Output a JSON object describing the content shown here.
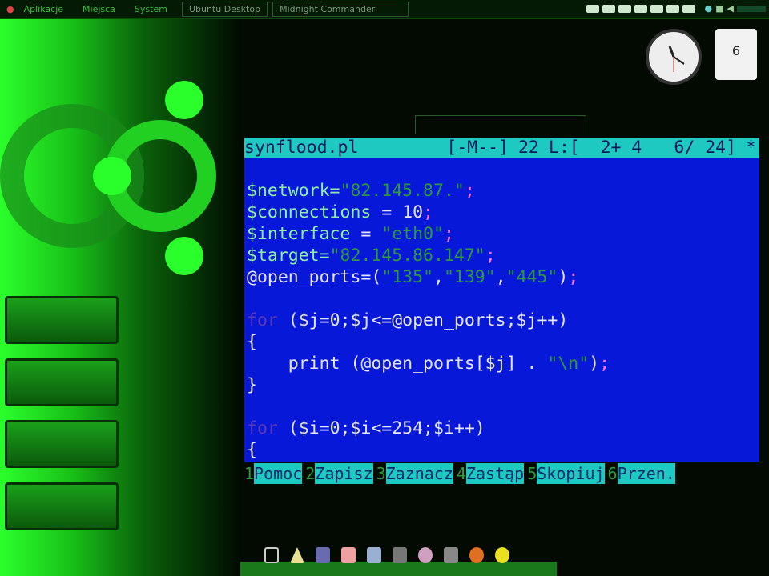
{
  "topbar": {
    "menus": [
      "Aplikacje",
      "Miejsca",
      "System"
    ],
    "tasks": [
      "Ubuntu Desktop",
      "Midnight Commander"
    ]
  },
  "calendar": {
    "day": "6"
  },
  "editor": {
    "tabs": [
      "",
      "",
      "",
      ""
    ],
    "status": {
      "filename": "synflood.pl",
      "mode": "[-M--]",
      "col": "22",
      "line": "L:[  2+ 4",
      "pos": "6/ 24]",
      "flag": "*"
    },
    "lines": [
      [
        {
          "c": "v",
          "t": "$network="
        },
        {
          "c": "s",
          "t": "\"82.145.87.\""
        },
        {
          "c": "p",
          "t": ";"
        }
      ],
      [
        {
          "c": "v",
          "t": "$connections"
        },
        {
          "c": "",
          "t": " = 10"
        },
        {
          "c": "p",
          "t": ";"
        }
      ],
      [
        {
          "c": "v",
          "t": "$interface"
        },
        {
          "c": "",
          "t": " = "
        },
        {
          "c": "s",
          "t": "\"eth0\""
        },
        {
          "c": "p",
          "t": ";"
        }
      ],
      [
        {
          "c": "v",
          "t": "$target="
        },
        {
          "c": "s",
          "t": "\"82.145.86.147\""
        },
        {
          "c": "p",
          "t": ";"
        }
      ],
      [
        {
          "c": "",
          "t": "@open_ports=("
        },
        {
          "c": "s",
          "t": "\"135\""
        },
        {
          "c": "",
          "t": ","
        },
        {
          "c": "s",
          "t": "\"139\""
        },
        {
          "c": "",
          "t": ","
        },
        {
          "c": "s",
          "t": "\"445\""
        },
        {
          "c": "",
          "t": ")"
        },
        {
          "c": "p",
          "t": ";"
        }
      ],
      [],
      [
        {
          "c": "k",
          "t": "for"
        },
        {
          "c": "",
          "t": " ($j=0;$j<=@open_ports;$j++)"
        }
      ],
      [
        {
          "c": "",
          "t": "{"
        }
      ],
      [
        {
          "c": "",
          "t": "    print (@open_ports[$j] . "
        },
        {
          "c": "s",
          "t": "\"\\n\""
        },
        {
          "c": "",
          "t": ")"
        },
        {
          "c": "p",
          "t": ";"
        }
      ],
      [
        {
          "c": "",
          "t": "}"
        }
      ],
      [],
      [
        {
          "c": "k",
          "t": "for"
        },
        {
          "c": "",
          "t": " ($i=0;$i<=254;$i++)"
        }
      ],
      [
        {
          "c": "",
          "t": "{"
        }
      ]
    ],
    "fkeys": [
      {
        "n": "1",
        "l": "Pomoc "
      },
      {
        "n": "2",
        "l": "Zapisz"
      },
      {
        "n": "3",
        "l": "Zaznacz"
      },
      {
        "n": "4",
        "l": "Zastąp"
      },
      {
        "n": "5",
        "l": "Skopiuj"
      },
      {
        "n": "6",
        "l": "Przen."
      }
    ]
  },
  "colors": {
    "editor_bg": "#0818d8",
    "status_bg": "#1ec9c2",
    "accent": "#2bff2b"
  }
}
